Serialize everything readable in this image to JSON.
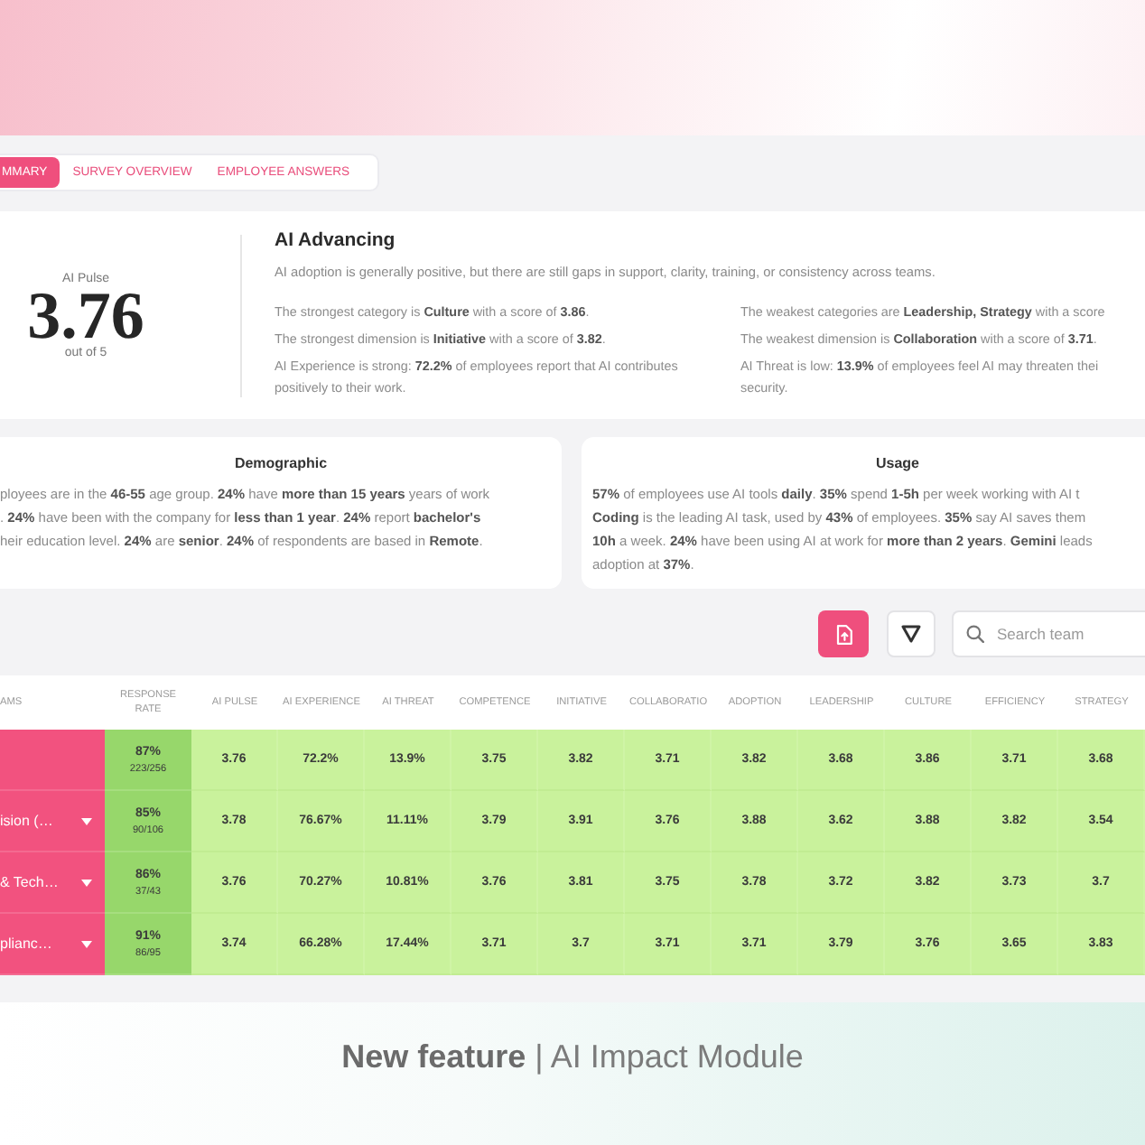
{
  "tabs": [
    {
      "label": "MMARY",
      "selected": true
    },
    {
      "label": "SURVEY OVERVIEW",
      "selected": false
    },
    {
      "label": "EMPLOYEE ANSWERS",
      "selected": false
    }
  ],
  "summary": {
    "score_label": "AI Pulse",
    "score": "3.76",
    "score_scale": "out of 5",
    "title": "AI Advancing",
    "description": "AI adoption is generally positive, but there are still gaps in support, clarity, training, or consistency across teams.",
    "insights": [
      "The strongest category is **Culture** with a score of **3.86**.",
      "The weakest categories are **Leadership, Strategy** with a score",
      "The strongest dimension is **Initiative** with a score of **3.82**.",
      "The weakest dimension is **Collaboration** with a score of **3.71**.",
      "AI Experience is strong: **72.2%** of employees report that AI contributes positively to their work.",
      "AI Threat is low: **13.9%** of employees feel AI may threaten thei\nsecurity."
    ]
  },
  "info_cards": [
    {
      "title": "Demographic",
      "text": "ployees are in the **46-55** age group. **24%** have **more than 15 years** years of work\n. **24%** have been with the company for **less than 1 year**. **24%** report **bachelor's**\nheir education level. **24%** are **senior**. **24%** of respondents are based in **Remote**."
    },
    {
      "title": "Usage",
      "text": "**57%** of employees use AI tools **daily**. **35%** spend **1-5h** per week working with AI t\n**Coding** is the leading AI task, used by **43%** of employees. **35%** say AI saves them\n**10h** a week. **24%** have been using AI at work for **more than 2 years**. **Gemini** leads\nadoption at **37%**."
    }
  ],
  "toolbar": {
    "search": {
      "placeholder": "Search team"
    }
  },
  "table": {
    "columns": [
      "AMS",
      "RESPONSE RATE",
      "AI PULSE",
      "AI EXPERIENCE",
      "AI THREAT",
      "COMPETENCE",
      "INITIATIVE",
      "COLLABORATIO",
      "ADOPTION",
      "LEADERSHIP",
      "CULTURE",
      "EFFICIENCY",
      "STRATEGY"
    ],
    "rows": [
      {
        "expandable": false,
        "response_rate": "87%",
        "responses": "223/256",
        "values": [
          "3.76",
          "72.2%",
          "13.9%",
          "3.75",
          "3.82",
          "3.71",
          "3.82",
          "3.68",
          "3.86",
          "3.71",
          "3.68"
        ]
      },
      {
        "team": "ision (…",
        "expandable": true,
        "response_rate": "85%",
        "responses": "90/106",
        "values": [
          "3.78",
          "76.67%",
          "11.11%",
          "3.79",
          "3.91",
          "3.76",
          "3.88",
          "3.62",
          "3.88",
          "3.82",
          "3.54"
        ]
      },
      {
        "team": "& Tech…",
        "expandable": true,
        "response_rate": "86%",
        "responses": "37/43",
        "values": [
          "3.76",
          "70.27%",
          "10.81%",
          "3.76",
          "3.81",
          "3.75",
          "3.78",
          "3.72",
          "3.82",
          "3.73",
          "3.7"
        ]
      },
      {
        "team": "plianc…",
        "expandable": true,
        "response_rate": "91%",
        "responses": "86/95",
        "values": [
          "3.74",
          "66.28%",
          "17.44%",
          "3.71",
          "3.7",
          "3.71",
          "3.71",
          "3.79",
          "3.76",
          "3.65",
          "3.83"
        ]
      }
    ]
  },
  "banner": {
    "text": "**New feature** | AI Impact Module"
  }
}
